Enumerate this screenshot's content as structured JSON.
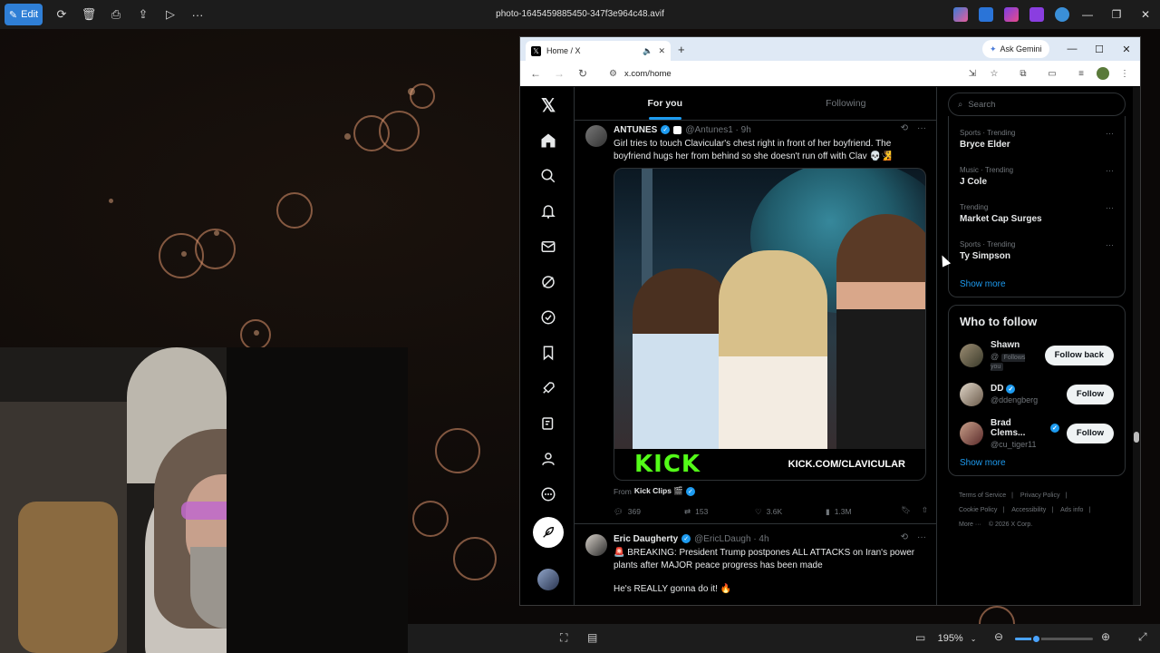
{
  "photos_app": {
    "edit_label": "Edit",
    "file_title": "photo-1645459885450-347f3e964c48.avif",
    "zoom": "195%"
  },
  "browser": {
    "tab_title": "Home / X",
    "ask_gemini": "Ask Gemini",
    "url": "x.com/home"
  },
  "x": {
    "tabs": [
      {
        "label": "For you"
      },
      {
        "label": "Following"
      }
    ],
    "search_placeholder": "Search",
    "tweets": [
      {
        "name": "ANTUNES",
        "handle": "@Antunes1 · 9h",
        "text": "Girl tries to touch Clavicular's chest right in front of her boyfriend. The boyfriend hugs her from behind so she doesn't run off with Clav 💀🧏",
        "media_logo": "KICK",
        "media_url": "KICK.COM/CLAVICULAR",
        "from_prefix": "From",
        "from_name": "Kick Clips 🎬",
        "replies": "369",
        "reposts": "153",
        "likes": "3.6K",
        "views": "1.3M"
      },
      {
        "name": "Eric Daugherty",
        "handle": "@EricLDaugh · 4h",
        "text": "🚨 BREAKING: President Trump postpones ALL ATTACKS on Iran's power plants after MAJOR peace progress has been made",
        "text2": "He's REALLY gonna do it! 🔥"
      }
    ],
    "trends": [
      {
        "meta": "Sports · Trending",
        "title": "Bryce Elder"
      },
      {
        "meta": "Music · Trending",
        "title": "J Cole"
      },
      {
        "meta": "Trending",
        "title": "Market Cap Surges"
      },
      {
        "meta": "Sports · Trending",
        "title": "Ty Simpson"
      }
    ],
    "show_more": "Show more",
    "who_to_follow": "Who to follow",
    "follow_suggestions": [
      {
        "name": "Shawn",
        "handle": "@",
        "badge": "Follows you",
        "button": "Follow back"
      },
      {
        "name": "DD",
        "handle": "@ddengberg",
        "button": "Follow"
      },
      {
        "name": "Brad Clems...",
        "handle": "@cu_tiger11",
        "button": "Follow"
      }
    ],
    "footer": {
      "terms": "Terms of Service",
      "privacy": "Privacy Policy",
      "cookie": "Cookie Policy",
      "accessibility": "Accessibility",
      "ads": "Ads info",
      "more": "More ···",
      "copyright": "© 2026 X Corp."
    }
  },
  "colors": {
    "accent": "#1d9bf0",
    "kick_green": "#53fc18",
    "edit_button": "#2f7fd6"
  }
}
